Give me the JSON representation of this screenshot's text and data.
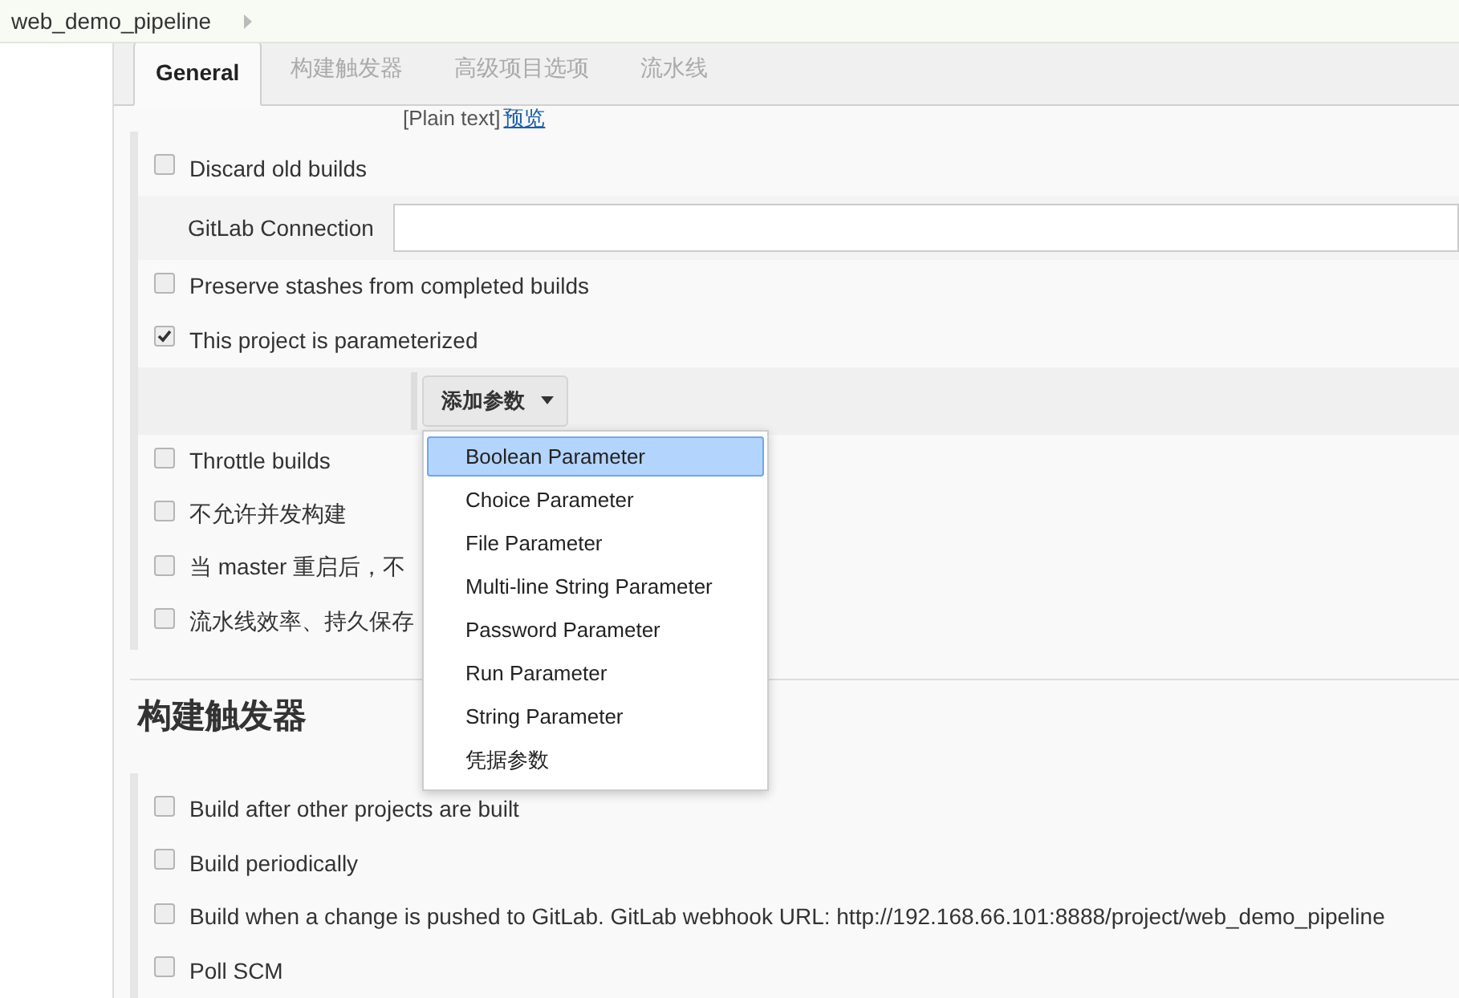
{
  "breadcrumb": {
    "items": [
      "web_demo_pipeline"
    ]
  },
  "tabs": [
    {
      "label": "General",
      "selected": true
    },
    {
      "label": "构建触发器",
      "selected": false
    },
    {
      "label": "高级项目选项",
      "selected": false
    },
    {
      "label": "流水线",
      "selected": false
    }
  ],
  "description_footer": {
    "format": "[Plain text]",
    "preview_link": "预览"
  },
  "general_options": [
    {
      "kind": "checkbox",
      "label": "Discard old builds",
      "checked": false
    },
    {
      "kind": "field",
      "label": "GitLab Connection"
    },
    {
      "kind": "checkbox",
      "label": "Preserve stashes from completed builds",
      "checked": false
    },
    {
      "kind": "checkbox",
      "label": "This project is parameterized",
      "checked": true
    },
    {
      "kind": "add_button",
      "label": "添加参数"
    },
    {
      "kind": "checkbox",
      "label": "Throttle builds",
      "checked": false
    },
    {
      "kind": "checkbox",
      "label": "不允许并发构建",
      "checked": false
    },
    {
      "kind": "checkbox",
      "label": "当 master 重启后，不",
      "checked": false
    },
    {
      "kind": "checkbox",
      "label": "流水线效率、持久保存",
      "checked": false
    }
  ],
  "add_parameter_menu": {
    "items": [
      {
        "label": "Boolean Parameter",
        "selected": true
      },
      {
        "label": "Choice Parameter",
        "selected": false
      },
      {
        "label": "File Parameter",
        "selected": false
      },
      {
        "label": "Multi-line String Parameter",
        "selected": false
      },
      {
        "label": "Password Parameter",
        "selected": false
      },
      {
        "label": "Run Parameter",
        "selected": false
      },
      {
        "label": "String Parameter",
        "selected": false
      },
      {
        "label": "凭据参数",
        "selected": false
      }
    ]
  },
  "triggers": {
    "heading": "构建触发器",
    "options": [
      {
        "label": "Build after other projects are built",
        "checked": false
      },
      {
        "label": "Build periodically",
        "checked": false
      },
      {
        "label": "Build when a change is pushed to GitLab. GitLab webhook URL: http://192.168.66.101:8888/project/web_demo_pipeline",
        "checked": false
      },
      {
        "label": "Poll SCM",
        "checked": false
      }
    ]
  }
}
